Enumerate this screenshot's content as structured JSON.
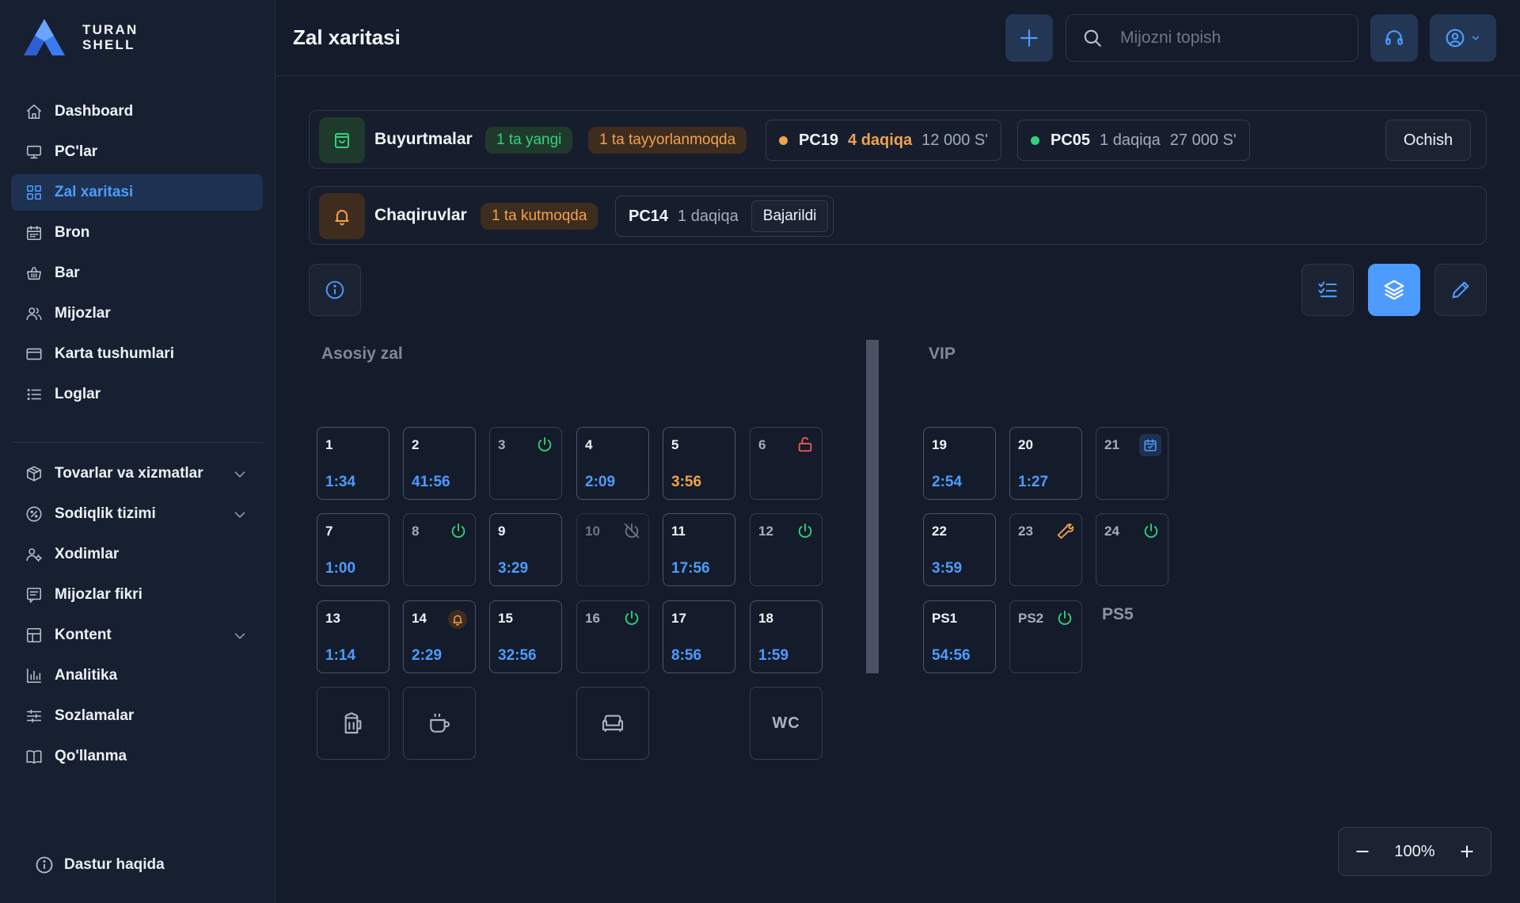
{
  "app": {
    "brand_line1": "TURAN",
    "brand_line2": "SHELL",
    "page_title": "Zal xaritasi"
  },
  "sidebar": {
    "items": [
      {
        "label": "Dashboard",
        "icon": "home-icon",
        "active": false
      },
      {
        "label": "PC'lar",
        "icon": "monitor-icon",
        "active": false
      },
      {
        "label": "Zal xaritasi",
        "icon": "grid-icon",
        "active": true
      },
      {
        "label": "Bron",
        "icon": "calendar-icon",
        "active": false
      },
      {
        "label": "Bar",
        "icon": "basket-icon",
        "active": false
      },
      {
        "label": "Mijozlar",
        "icon": "users-icon",
        "active": false
      },
      {
        "label": "Karta tushumlari",
        "icon": "card-icon",
        "active": false
      },
      {
        "label": "Loglar",
        "icon": "list-icon",
        "active": false
      }
    ],
    "items2": [
      {
        "label": "Tovarlar va xizmatlar",
        "icon": "box-icon",
        "expandable": true
      },
      {
        "label": "Sodiqlik tizimi",
        "icon": "percent-badge-icon",
        "expandable": true
      },
      {
        "label": "Xodimlar",
        "icon": "staff-icon",
        "expandable": false
      },
      {
        "label": "Mijozlar fikri",
        "icon": "feedback-icon",
        "expandable": false
      },
      {
        "label": "Kontent",
        "icon": "layout-icon",
        "expandable": true
      },
      {
        "label": "Analitika",
        "icon": "chart-icon",
        "expandable": false
      },
      {
        "label": "Sozlamalar",
        "icon": "sliders-icon",
        "expandable": false
      },
      {
        "label": "Qo'llanma",
        "icon": "book-icon",
        "expandable": false
      }
    ],
    "about": "Dastur haqida"
  },
  "search": {
    "placeholder": "Mijozni topish"
  },
  "orders": {
    "label": "Buyurtmalar",
    "new_badge": "1 ta yangi",
    "preparing_badge": "1 ta tayyorlanmoqda",
    "entries": [
      {
        "pc": "PC19",
        "time": "4 daqiqa",
        "amount": "12 000 S'",
        "status_color": "#f0a24e",
        "time_color": "#f0a24e"
      },
      {
        "pc": "PC05",
        "time": "1 daqiqa",
        "amount": "27 000 S'",
        "status_color": "#34d27b",
        "time_color": "#a3acba"
      }
    ],
    "open_button": "Ochish"
  },
  "calls": {
    "label": "Chaqiruvlar",
    "waiting_badge": "1 ta kutmoqda",
    "entry": {
      "pc": "PC14",
      "time": "1 daqiqa",
      "done_button": "Bajarildi"
    }
  },
  "zoom": {
    "value": "100%"
  },
  "colors": {
    "accent": "#4e9bff",
    "green": "#34d27b",
    "orange": "#f0a24e",
    "red": "#ef5a5a"
  },
  "map": {
    "zones": [
      {
        "name": "Asosiy zal"
      },
      {
        "name": "VIP"
      }
    ],
    "main_tiles": [
      {
        "num": "1",
        "time": "1:34",
        "time_color": "blue",
        "status": "busy"
      },
      {
        "num": "2",
        "time": "41:56",
        "time_color": "blue",
        "status": "busy"
      },
      {
        "num": "3",
        "time": "",
        "status": "off"
      },
      {
        "num": "4",
        "time": "2:09",
        "time_color": "blue",
        "status": "busy"
      },
      {
        "num": "5",
        "time": "3:56",
        "time_color": "orange",
        "status": "busy"
      },
      {
        "num": "6",
        "time": "",
        "status": "locked"
      },
      {
        "num": "7",
        "time": "1:00",
        "time_color": "blue",
        "status": "busy"
      },
      {
        "num": "8",
        "time": "",
        "status": "off"
      },
      {
        "num": "9",
        "time": "3:29",
        "time_color": "blue",
        "status": "busy"
      },
      {
        "num": "10",
        "time": "",
        "status": "offline"
      },
      {
        "num": "11",
        "time": "17:56",
        "time_color": "blue",
        "status": "busy"
      },
      {
        "num": "12",
        "time": "",
        "status": "off"
      },
      {
        "num": "13",
        "time": "1:14",
        "time_color": "blue",
        "status": "busy"
      },
      {
        "num": "14",
        "time": "2:29",
        "time_color": "blue",
        "status": "calling"
      },
      {
        "num": "15",
        "time": "32:56",
        "time_color": "blue",
        "status": "busy"
      },
      {
        "num": "16",
        "time": "",
        "status": "off"
      },
      {
        "num": "17",
        "time": "8:56",
        "time_color": "blue",
        "status": "busy"
      },
      {
        "num": "18",
        "time": "1:59",
        "time_color": "blue",
        "status": "busy"
      }
    ],
    "facilities": [
      {
        "name": "beer-icon"
      },
      {
        "name": "coffee-icon"
      },
      {
        "name": "sofa-icon"
      },
      {
        "label": "WC"
      }
    ],
    "vip_tiles": [
      {
        "num": "19",
        "time": "2:54",
        "time_color": "blue",
        "status": "busy"
      },
      {
        "num": "20",
        "time": "1:27",
        "time_color": "blue",
        "status": "busy"
      },
      {
        "num": "21",
        "time": "",
        "status": "reserved"
      },
      {
        "num": "22",
        "time": "3:59",
        "time_color": "blue",
        "status": "busy"
      },
      {
        "num": "23",
        "time": "",
        "status": "maintenance"
      },
      {
        "num": "24",
        "time": "",
        "status": "off"
      },
      {
        "num": "PS1",
        "time": "54:56",
        "time_color": "blue",
        "status": "busy"
      },
      {
        "num": "PS2",
        "time": "",
        "status": "off"
      }
    ],
    "ps5_label": "PS5"
  }
}
